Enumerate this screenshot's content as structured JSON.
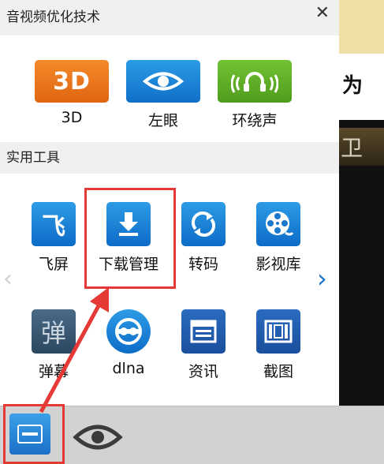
{
  "section_av": {
    "title": "音视频优化技术",
    "close_symbol": "✕",
    "items": [
      {
        "label": "3D",
        "icon": "3d-icon",
        "color": "#e8771b",
        "icon_text": "3D"
      },
      {
        "label": "左眼",
        "icon": "eye-icon",
        "color": "#1a8ad9"
      },
      {
        "label": "环绕声",
        "icon": "surround-sound-icon",
        "color": "#5db025"
      }
    ]
  },
  "section_tools": {
    "title": "实用工具",
    "row1": [
      {
        "label": "飞屏",
        "icon": "fly-screen-icon",
        "icon_text": "飞"
      },
      {
        "label": "下载管理",
        "icon": "download-icon"
      },
      {
        "label": "转码",
        "icon": "transcode-icon"
      },
      {
        "label": "影视库",
        "icon": "film-library-icon"
      }
    ],
    "row2": [
      {
        "label": "弹幕",
        "icon": "danmaku-icon",
        "icon_text": "弹"
      },
      {
        "label": "dlna",
        "icon": "dlna-icon"
      },
      {
        "label": "资讯",
        "icon": "news-icon"
      },
      {
        "label": "截图",
        "icon": "screenshot-icon"
      }
    ]
  },
  "nav": {
    "prev": "‹",
    "next": "›"
  },
  "background": {
    "headline_char": "为",
    "video_text": "卫"
  },
  "bottom_bar": {
    "items": [
      "toolbox-panel-icon",
      "eye-icon"
    ]
  },
  "annotation_color": "#e53935"
}
